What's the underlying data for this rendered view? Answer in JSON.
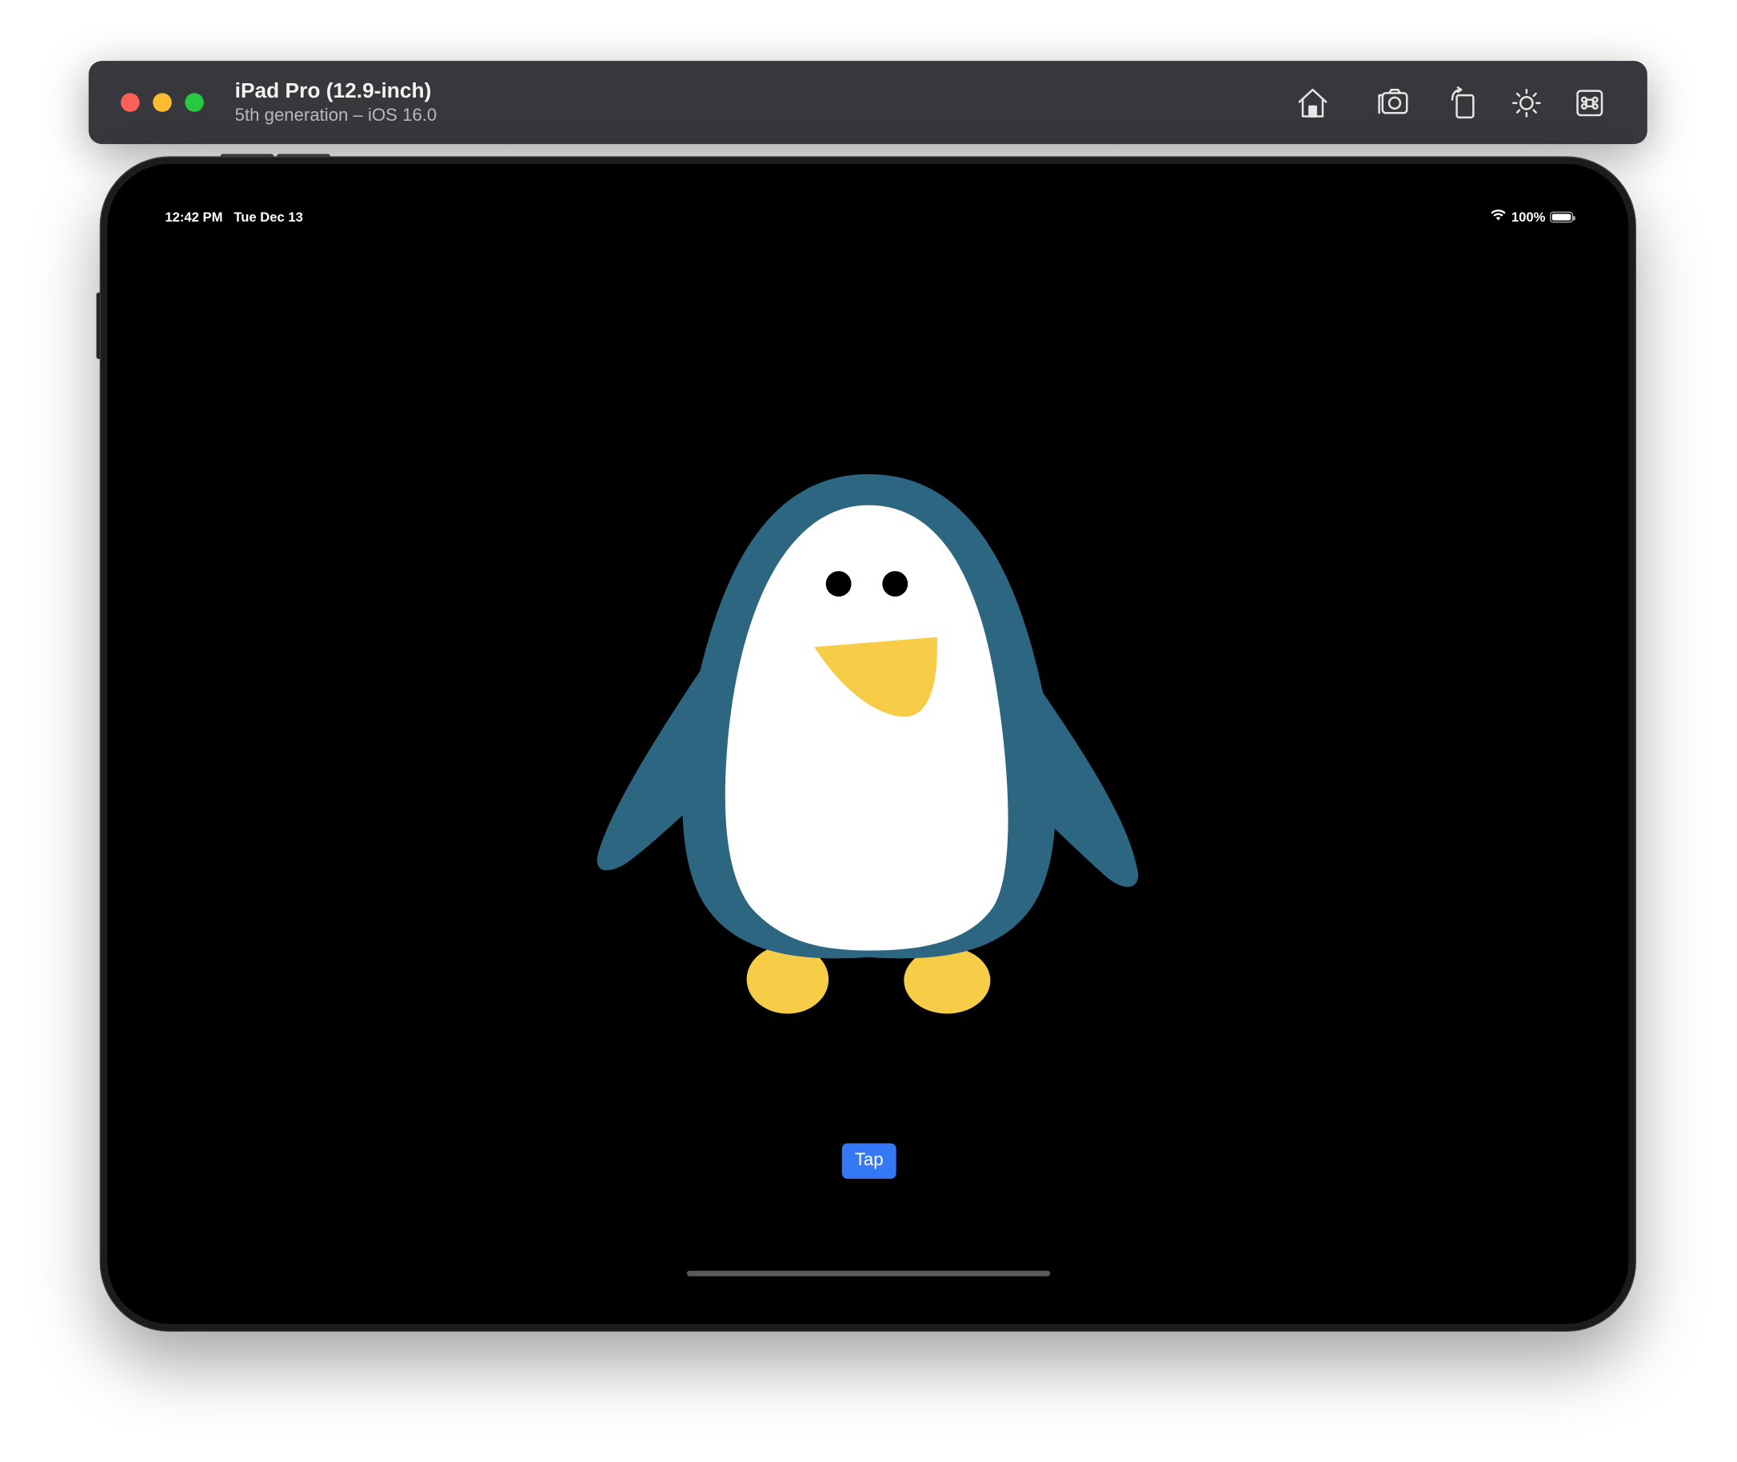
{
  "window": {
    "title": "iPad Pro (12.9-inch)",
    "subtitle": "5th generation – iOS 16.0",
    "toolbar_icons": [
      "home-icon",
      "screenshot-icon",
      "rotate-icon",
      "appearance-icon",
      "command-icon"
    ]
  },
  "status_bar": {
    "time": "12:42 PM",
    "date": "Tue Dec 13",
    "battery_percent": "100%",
    "battery_level": 1.0
  },
  "app": {
    "button_label": "Tap",
    "colors": {
      "background": "#000000",
      "penguin_body": "#2c6680",
      "penguin_belly": "#ffffff",
      "beak_feet": "#f7cd48",
      "eyes": "#000000",
      "button": "#3478f6"
    }
  }
}
